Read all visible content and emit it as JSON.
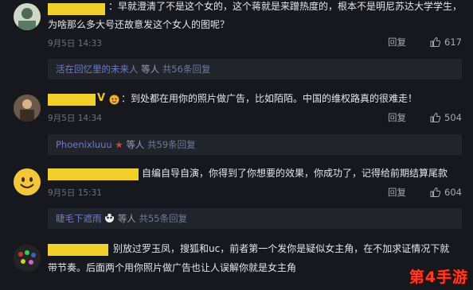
{
  "comments": [
    {
      "text_line1": "：早就澄清了不是这个女的，这个蒋就是来蹭热度的，根本不是明尼苏达大学学生，",
      "text_line2": "为啥那么多大号还故意发这个女人的图呢？",
      "time": "9月5日 14:33",
      "reply_label": "回复",
      "likes": "617",
      "sub_user": "活在回忆里的未来人",
      "sub_tail": "等人",
      "sub_more": "共56条回复"
    },
    {
      "text_line1": "：到处都在用你的照片做广告，比如陌陌。中国的维权路真的很难走！",
      "time": "9月5日 14:34",
      "reply_label": "回复",
      "likes": "504",
      "sub_user": "Phoenixluuu",
      "sub_tail": "等人",
      "sub_more": "共59条回复"
    },
    {
      "text_line1": "自编自导自演，你得到了你想要的效果，你成功了，记得给前期结算尾款",
      "time": "9月5日 15:31",
      "reply_label": "回复",
      "likes": "604",
      "sub_user": "睫毛下遮雨",
      "sub_tail": "等人",
      "sub_more": "共55条回复"
    },
    {
      "text_line1": "别放过罗玉凤，搜狐和uc，前者第一个发你是疑似女主角，在不加求证情况下就",
      "text_line2": "带节奏。后面两个用你照片做广告也让人误解你就是女主角"
    }
  ],
  "watermark": "第4手游",
  "colors": {
    "background": "#17181d",
    "name_highlight": "#f1d02a",
    "sub_name": "#6d7bc9",
    "watermark": "#ff3b22"
  }
}
